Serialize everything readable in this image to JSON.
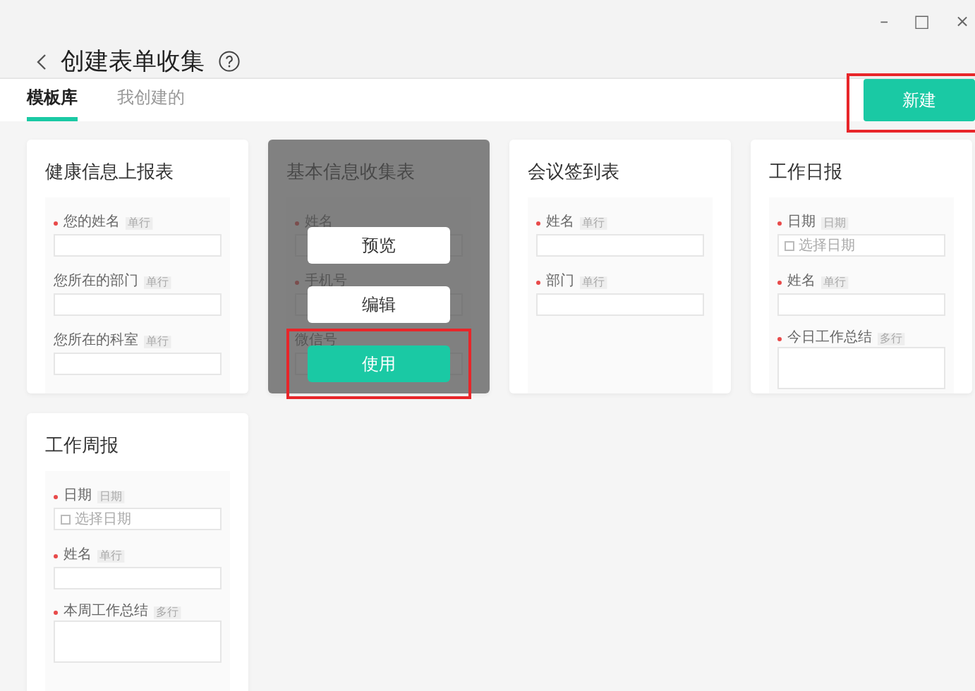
{
  "window": {
    "title": "创建表单收集",
    "controls": [
      "–",
      "□",
      "×"
    ]
  },
  "tabs": [
    {
      "label": "模板库",
      "selected": true
    },
    {
      "label": "我创建的",
      "selected": false
    }
  ],
  "new_button": {
    "label": "新建",
    "highlighted": true
  },
  "templates": [
    {
      "title": "健康信息上报表",
      "hovered": false,
      "fields": [
        {
          "kind": "text",
          "label": "您的姓名",
          "required": true,
          "tag": "单行"
        },
        {
          "kind": "text",
          "label": "您所在的部门",
          "required": false,
          "tag": "单行"
        },
        {
          "kind": "text",
          "label": "您所在的科室",
          "required": false,
          "tag": "单行"
        }
      ]
    },
    {
      "title": "基本信息收集表",
      "hovered": true,
      "fields": [
        {
          "kind": "text",
          "label": "姓名",
          "required": true
        },
        {
          "kind": "text",
          "label": "手机号",
          "required": true
        },
        {
          "kind": "text",
          "label": "微信号",
          "required": false
        }
      ],
      "actions": [
        {
          "label": "预览",
          "kind": "plain",
          "highlighted": false
        },
        {
          "label": "编辑",
          "kind": "plain",
          "highlighted": false
        },
        {
          "label": "使用",
          "kind": "primary",
          "highlighted": true
        }
      ]
    },
    {
      "title": "会议签到表",
      "hovered": false,
      "fields": [
        {
          "kind": "text",
          "label": "姓名",
          "required": true,
          "tag": "单行"
        },
        {
          "kind": "text",
          "label": "部门",
          "required": true,
          "tag": "单行"
        }
      ]
    },
    {
      "title": "工作日报",
      "hovered": false,
      "fields": [
        {
          "kind": "date",
          "label": "日期",
          "required": true,
          "tag": "日期",
          "placeholder": "选择日期"
        },
        {
          "kind": "text",
          "label": "姓名",
          "required": true,
          "tag": "单行"
        },
        {
          "kind": "textarea",
          "label": "今日工作总结",
          "required": true,
          "tag": "多行"
        }
      ]
    },
    {
      "title": "工作周报",
      "hovered": false,
      "fields": [
        {
          "kind": "date",
          "label": "日期",
          "required": true,
          "tag": "日期",
          "placeholder": "选择日期"
        },
        {
          "kind": "text",
          "label": "姓名",
          "required": true,
          "tag": "单行"
        },
        {
          "kind": "textarea",
          "label": "本周工作总结",
          "required": true,
          "tag": "多行"
        }
      ]
    }
  ]
}
